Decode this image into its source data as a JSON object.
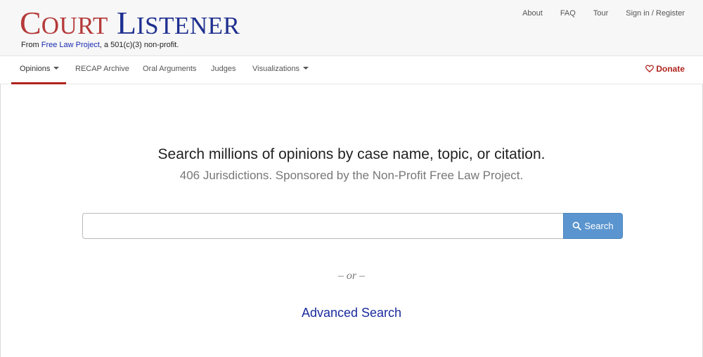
{
  "brand": {
    "logo_c": "C",
    "logo_ourt": "OURT",
    "logo_l": "L",
    "logo_istener": "ISTENER",
    "tagline_prefix": "From ",
    "tagline_link": "Free Law Project",
    "tagline_suffix": ", a 501(c)(3) non-profit.",
    "court_color": "#b53a3a",
    "listener_color": "#1e2f8f"
  },
  "top_links": [
    "About",
    "FAQ",
    "Tour",
    "Sign in / Register"
  ],
  "nav": {
    "items": [
      {
        "label": "Opinions",
        "dropdown": true,
        "active": true
      },
      {
        "label": "RECAP Archive",
        "dropdown": false,
        "active": false
      },
      {
        "label": "Oral Arguments",
        "dropdown": false,
        "active": false
      },
      {
        "label": "Judges",
        "dropdown": false,
        "active": false
      },
      {
        "label": "Visualizations",
        "dropdown": true,
        "active": false
      }
    ],
    "donate_label": "Donate",
    "accent_color": "#b0241e"
  },
  "main": {
    "headline": "Search millions of opinions by case name, topic, or citation.",
    "subline": "406 Jurisdictions. Sponsored by the Non-Profit Free Law Project.",
    "search_value": "",
    "search_button": "Search",
    "or_text": "– or –",
    "advanced_link": "Advanced Search",
    "button_color": "#5b95cf"
  }
}
